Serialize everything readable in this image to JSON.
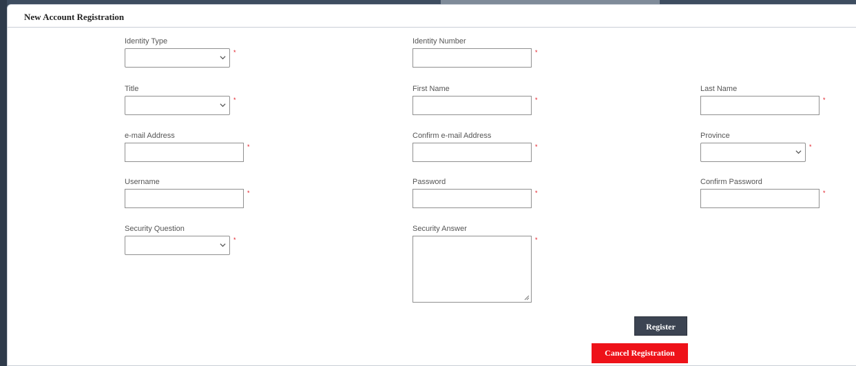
{
  "form": {
    "title": "New Account Registration",
    "required_marker": "*",
    "fields": {
      "identity_type": {
        "label": "Identity Type",
        "value": ""
      },
      "identity_number": {
        "label": "Identity Number",
        "value": ""
      },
      "title": {
        "label": "Title",
        "value": ""
      },
      "first_name": {
        "label": "First Name",
        "value": ""
      },
      "last_name": {
        "label": "Last Name",
        "value": ""
      },
      "email": {
        "label": "e-mail Address",
        "value": ""
      },
      "confirm_email": {
        "label": "Confirm e-mail Address",
        "value": ""
      },
      "province": {
        "label": "Province",
        "value": ""
      },
      "username": {
        "label": "Username",
        "value": ""
      },
      "password": {
        "label": "Password",
        "value": ""
      },
      "confirm_password": {
        "label": "Confirm Password",
        "value": ""
      },
      "security_question": {
        "label": "Security Question",
        "value": ""
      },
      "security_answer": {
        "label": "Security Answer",
        "value": ""
      }
    },
    "buttons": {
      "register": "Register",
      "cancel": "Cancel Registration"
    }
  },
  "colors": {
    "required": "#e0161f",
    "register_bg": "#3c4452",
    "cancel_bg": "#ee1219",
    "chrome_dark": "#3b4a5c"
  }
}
